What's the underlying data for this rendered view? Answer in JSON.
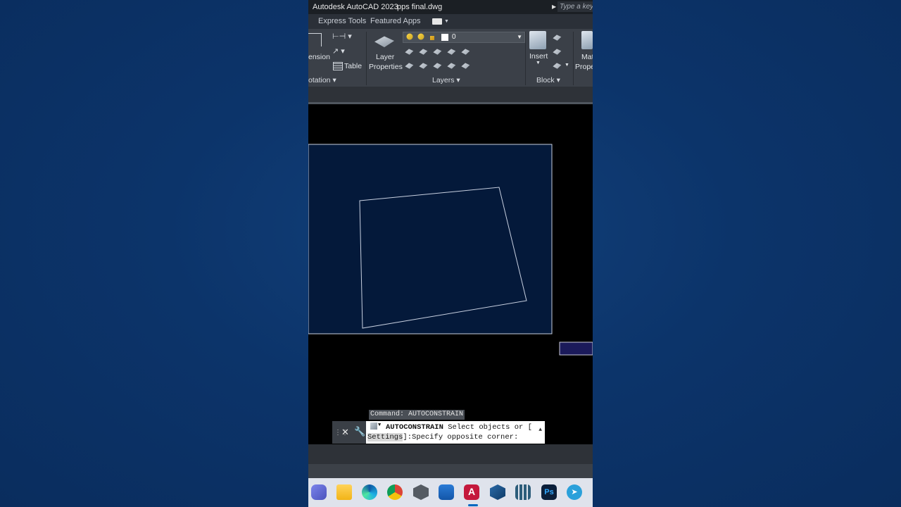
{
  "window": {
    "app_title": "Autodesk AutoCAD 2023",
    "file_name": "pps final.dwg",
    "search_placeholder": "Type a keyw"
  },
  "tabs": [
    {
      "label": "Express Tools"
    },
    {
      "label": "Featured Apps"
    }
  ],
  "ribbon": {
    "annotation": {
      "dimension_label": "ension",
      "table_label": "Table",
      "footer": "otation"
    },
    "layers": {
      "layer_properties_line1": "Layer",
      "layer_properties_line2": "Properties",
      "current_layer": "0",
      "footer": "Layers"
    },
    "block": {
      "insert_label": "Insert",
      "footer": "Block"
    },
    "properties": {
      "match_line1": "Mat",
      "match_line2": "Prope"
    }
  },
  "command": {
    "history": "Command: AUTOCONSTRAIN",
    "name": "AUTOCONSTRAIN",
    "line1_rest": " Select objects or [",
    "option": "Settings",
    "line2_rest": "]:Specify opposite corner:"
  },
  "colors": {
    "desktop_bg": "#0b3266",
    "selection_fill": "#04193a",
    "selection_border": "#c8d0e0",
    "ribbon_bg": "#3b4048",
    "accent": "#0067c0"
  },
  "taskbar": {
    "icons": [
      "teams-icon",
      "file-explorer-icon",
      "edge-icon",
      "chrome-icon",
      "3d-app-icon",
      "microsoft-store-icon",
      "autocad-icon",
      "sketchup-icon",
      "grid-app-icon",
      "photoshop-icon",
      "telegram-icon"
    ],
    "active": "autocad-icon"
  }
}
